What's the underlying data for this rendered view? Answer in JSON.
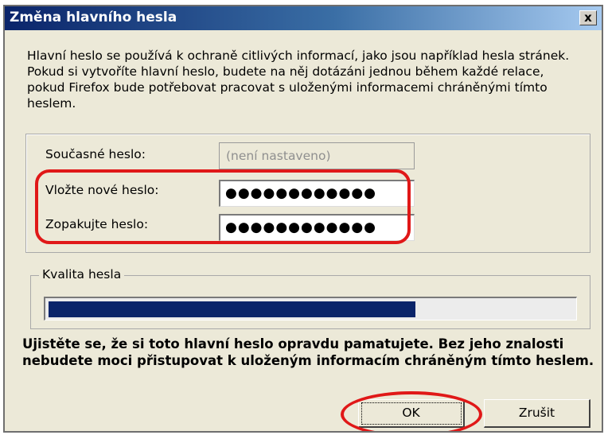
{
  "dialog": {
    "title": "Změna hlavního hesla",
    "close_glyph": "x",
    "intro": "Hlavní heslo se používá k ochraně citlivých informací, jako jsou například hesla stránek. Pokud si vytvoříte hlavní heslo, budete na něj dotázáni jednou během každé relace, pokud Firefox bude potřebovat pracovat s uloženými informacemi chráněnými tímto heslem."
  },
  "password_fields": {
    "current_label": "Současné heslo:",
    "current_value": "(není nastaveno)",
    "new_label": "Vložte nové heslo:",
    "new_value": "●●●●●●●●●●●●",
    "confirm_label": "Zopakujte heslo:",
    "confirm_value": "●●●●●●●●●●●●"
  },
  "quality": {
    "label": "Kvalita hesla",
    "level": 0.7
  },
  "warning": "Ujistěte se, že si toto hlavní heslo opravdu pamatujete. Bez jeho znalosti nebudete moci přistupovat k uloženým informacím chráněným tímto heslem.",
  "buttons": {
    "ok": "OK",
    "cancel": "Zrušit"
  },
  "colors": {
    "titlebar": "#0a246a",
    "dialog_bg": "#ece9d8",
    "progress_fill": "#0a246a",
    "highlight": "#e01818"
  }
}
